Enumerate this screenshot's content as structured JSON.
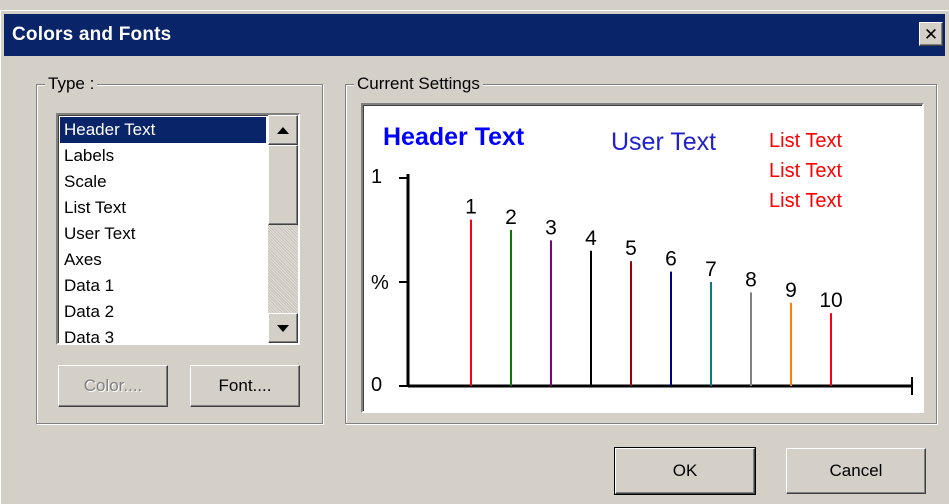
{
  "dialog": {
    "title": "Colors and Fonts",
    "close_glyph": "✕"
  },
  "type_group": {
    "label": "Type :",
    "items": [
      {
        "label": "Header Text",
        "selected": true
      },
      {
        "label": "Labels",
        "selected": false
      },
      {
        "label": "Scale",
        "selected": false
      },
      {
        "label": "List Text",
        "selected": false
      },
      {
        "label": "User Text",
        "selected": false
      },
      {
        "label": "Axes",
        "selected": false
      },
      {
        "label": "Data 1",
        "selected": false
      },
      {
        "label": "Data 2",
        "selected": false
      },
      {
        "label": "Data 3",
        "selected": false
      }
    ],
    "color_button": "Color....",
    "font_button": "Font...."
  },
  "settings_group": {
    "label": "Current Settings"
  },
  "preview": {
    "header_text": "Header Text",
    "user_text": "User Text",
    "list_texts": [
      "List Text",
      "List Text",
      "List Text"
    ],
    "y_top": "1",
    "y_mid": "%",
    "y_bottom": "0",
    "colors": {
      "header": "#0000ff",
      "user": "#2222cc",
      "list": "#ff0000"
    }
  },
  "chart_data": {
    "type": "bar",
    "categories": [
      "1",
      "2",
      "3",
      "4",
      "5",
      "6",
      "7",
      "8",
      "9",
      "10"
    ],
    "values": [
      0.8,
      0.75,
      0.7,
      0.65,
      0.6,
      0.55,
      0.5,
      0.45,
      0.4,
      0.35
    ],
    "colors": [
      "#ff0000",
      "#008000",
      "#800080",
      "#000000",
      "#a00000",
      "#000080",
      "#008080",
      "#808080",
      "#ff8000",
      "#ff0000"
    ],
    "ylim": [
      0,
      1
    ]
  },
  "footer": {
    "ok": "OK",
    "cancel": "Cancel"
  }
}
